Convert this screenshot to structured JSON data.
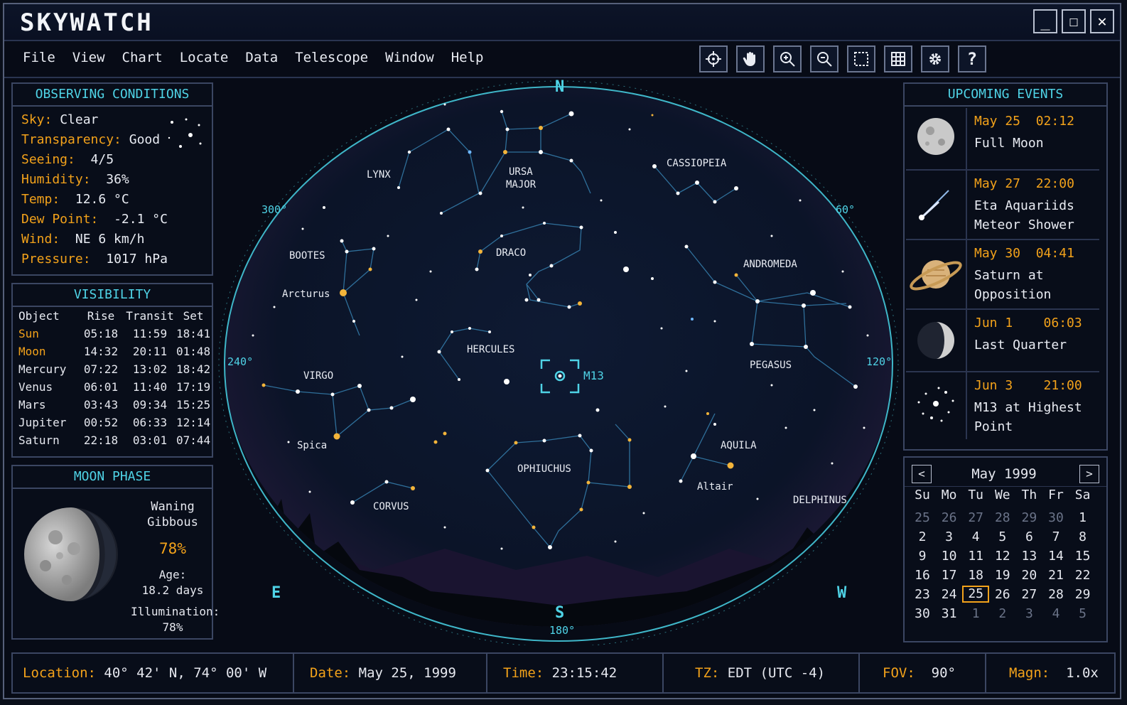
{
  "app": {
    "title": "SKYWATCH"
  },
  "window_controls": {
    "minimize": "_",
    "maximize": "☐",
    "close": "✕"
  },
  "menu": [
    "File",
    "View",
    "Chart",
    "Locate",
    "Data",
    "Telescope",
    "Window",
    "Help"
  ],
  "toolbar": [
    "crosshair-icon",
    "hand-icon",
    "zoom-in-icon",
    "zoom-out-icon",
    "select-icon",
    "grid-icon",
    "gear-icon",
    "help-icon"
  ],
  "observing": {
    "title": "OBSERVING CONDITIONS",
    "sky": {
      "label": "Sky:",
      "value": "Clear"
    },
    "transparency": {
      "label": "Transparency:",
      "value": "Good"
    },
    "seeing": {
      "label": "Seeing:",
      "value": "4/5"
    },
    "humidity": {
      "label": "Humidity:",
      "value": "36%"
    },
    "temp": {
      "label": "Temp:",
      "value": "12.6 °C"
    },
    "dew": {
      "label": "Dew Point:",
      "value": "-2.1 °C"
    },
    "wind": {
      "label": "Wind:",
      "value": "NE 6 km/h"
    },
    "pressure": {
      "label": "Pressure:",
      "value": "1017 hPa"
    }
  },
  "visibility": {
    "title": "VISIBILITY",
    "headers": [
      "Object",
      "Rise",
      "Transit",
      "Set"
    ],
    "rows": [
      {
        "object": "Sun",
        "rise": "05:18",
        "transit": "11:59",
        "set": "18:41"
      },
      {
        "object": "Moon",
        "rise": "14:32",
        "transit": "20:11",
        "set": "01:48"
      },
      {
        "object": "Mercury",
        "rise": "07:22",
        "transit": "13:02",
        "set": "18:42"
      },
      {
        "object": "Venus",
        "rise": "06:01",
        "transit": "11:40",
        "set": "17:19"
      },
      {
        "object": "Mars",
        "rise": "03:43",
        "transit": "09:34",
        "set": "15:25"
      },
      {
        "object": "Jupiter",
        "rise": "00:52",
        "transit": "06:33",
        "set": "12:14"
      },
      {
        "object": "Saturn",
        "rise": "22:18",
        "transit": "03:01",
        "set": "07:44"
      }
    ]
  },
  "moon": {
    "title": "MOON PHASE",
    "phase_line1": "Waning",
    "phase_line2": "Gibbous",
    "percent": "78%",
    "age_label": "Age:",
    "age_value": "18.2 days",
    "illum_label": "Illumination:",
    "illum_value": "78%"
  },
  "sky": {
    "compass": {
      "n": "N",
      "s": "S",
      "e": "E",
      "w": "W"
    },
    "degrees": [
      "300°",
      "60°",
      "240°",
      "120°",
      "180°"
    ],
    "constellations": [
      "LYNX",
      "URSA",
      "MAJOR",
      "CASSIOPEIA",
      "BOOTES",
      "DRACO",
      "ANDROMEDA",
      "HERCULES",
      "VIRGO",
      "PEGASUS",
      "OPHIUCHUS",
      "AQUILA",
      "CORVUS",
      "DELPHINUS"
    ],
    "stars": [
      "Arcturus",
      "Spica",
      "Altair"
    ],
    "target": "M13"
  },
  "events": {
    "title": "UPCOMING EVENTS",
    "items": [
      {
        "date": "May 25",
        "time": "02:12",
        "line1": "Full Moon",
        "line2": "",
        "icon": "full-moon-icon"
      },
      {
        "date": "May 27",
        "time": "22:00",
        "line1": "Eta Aquariids",
        "line2": "Meteor Shower",
        "icon": "meteor-icon"
      },
      {
        "date": "May 30",
        "time": "04:41",
        "line1": "Saturn at",
        "line2": "Opposition",
        "icon": "saturn-icon"
      },
      {
        "date": "Jun 1",
        "time": "06:03",
        "line1": "Last Quarter",
        "line2": "",
        "icon": "last-quarter-moon-icon"
      },
      {
        "date": "Jun 3",
        "time": "21:00",
        "line1": "M13 at Highest",
        "line2": "Point",
        "icon": "star-cluster-icon"
      }
    ]
  },
  "calendar": {
    "month": "May 1999",
    "prev": "<",
    "next": ">",
    "weekdays": [
      "Su",
      "Mo",
      "Tu",
      "We",
      "Th",
      "Fr",
      "Sa"
    ],
    "days": [
      "25",
      "26",
      "27",
      "28",
      "29",
      "30",
      "1",
      "2",
      "3",
      "4",
      "5",
      "6",
      "7",
      "8",
      "9",
      "10",
      "11",
      "12",
      "13",
      "14",
      "15",
      "16",
      "17",
      "18",
      "19",
      "20",
      "21",
      "22",
      "23",
      "24",
      "25",
      "26",
      "27",
      "28",
      "29",
      "30",
      "31",
      "1",
      "2",
      "3",
      "4",
      "5"
    ],
    "selected": "25"
  },
  "status": {
    "location": {
      "label": "Location:",
      "value": "40° 42' N, 74° 00' W"
    },
    "date": {
      "label": "Date:",
      "value": "May 25, 1999"
    },
    "time": {
      "label": "Time:",
      "value": "23:15:42"
    },
    "tz": {
      "label": "TZ:",
      "value": "EDT (UTC -4)"
    },
    "fov": {
      "label": "FOV:",
      "value": "90°"
    },
    "magn": {
      "label": "Magn:",
      "value": "1.0x"
    }
  },
  "colors": {
    "accent": "#4fd3e6",
    "label": "#f3a21a",
    "border": "#3b4662"
  }
}
